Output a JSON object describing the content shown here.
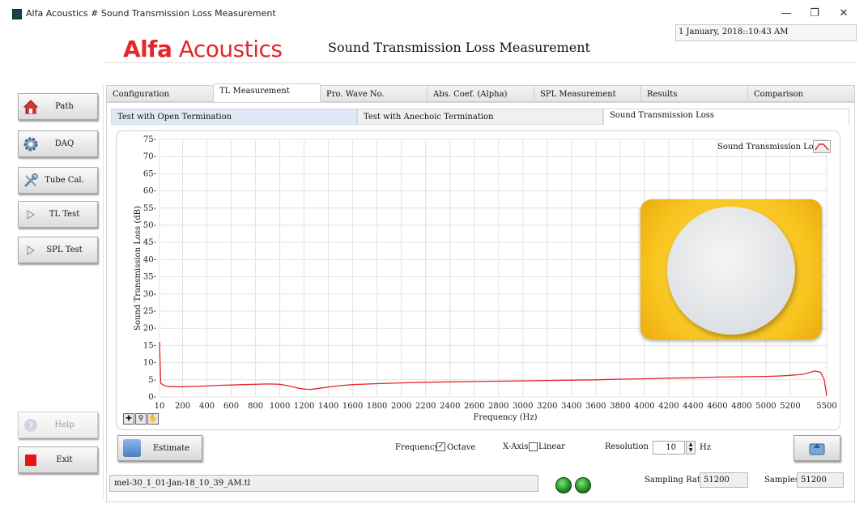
{
  "window": {
    "title": "Alfa Acoustics # Sound Transmission Loss Measurement",
    "min_glyph": "—",
    "max_glyph": "❐",
    "close_glyph": "✕"
  },
  "header": {
    "brand_first": "Alfa",
    "brand_second": " Acoustics",
    "title": "Sound Transmission Loss Measurement",
    "datetime": "1 January, 2018::10:43 AM",
    "brand_color": "#e5262c"
  },
  "sidebar": {
    "items": [
      {
        "label": "Path",
        "icon": "home-icon"
      },
      {
        "label": "DAQ",
        "icon": "gear-icon"
      },
      {
        "label": "Tube Cal.",
        "icon": "tools-icon"
      },
      {
        "label": "TL Test",
        "icon": "play-icon"
      },
      {
        "label": "SPL Test",
        "icon": "play-icon"
      }
    ],
    "help_label": "Help",
    "exit_label": "Exit"
  },
  "tabs": [
    {
      "label": "Configuration",
      "active": false
    },
    {
      "label": "TL Measurement",
      "active": true
    },
    {
      "label": "Pro. Wave No.",
      "active": false
    },
    {
      "label": "Abs. Coef. (Alpha)",
      "active": false
    },
    {
      "label": "SPL Measurement",
      "active": false
    },
    {
      "label": "Results",
      "active": false
    },
    {
      "label": "Comparison",
      "active": false
    }
  ],
  "subtabs": [
    {
      "label": "Test with Open Termination"
    },
    {
      "label": "Test with Anechoic Termination"
    },
    {
      "label": "Sound Transmission Loss"
    }
  ],
  "chart_data": {
    "type": "line",
    "xlabel": "Frequency (Hz)",
    "ylabel": "Sound Transmission Loss (dB)",
    "xlim": [
      10,
      5500
    ],
    "ylim": [
      0,
      75
    ],
    "x_ticks": [
      10,
      200,
      400,
      600,
      800,
      1000,
      1200,
      1400,
      1600,
      1800,
      2000,
      2200,
      2400,
      2600,
      2800,
      3000,
      3200,
      3400,
      3600,
      3800,
      4000,
      4200,
      4400,
      4600,
      4800,
      5000,
      5200,
      5500
    ],
    "y_ticks": [
      0,
      5,
      10,
      15,
      20,
      25,
      30,
      35,
      40,
      45,
      50,
      55,
      60,
      65,
      70,
      75
    ],
    "grid": true,
    "legend_position": "top-right",
    "series": [
      {
        "name": "Sound Transmission Loss",
        "color": "#e8242a",
        "x": [
          10,
          20,
          40,
          60,
          100,
          200,
          300,
          400,
          500,
          600,
          700,
          800,
          900,
          1000,
          1050,
          1100,
          1150,
          1200,
          1250,
          1300,
          1400,
          1500,
          1600,
          1800,
          2000,
          2200,
          2400,
          2600,
          2800,
          3000,
          3200,
          3400,
          3600,
          3800,
          4000,
          4200,
          4400,
          4600,
          4800,
          5000,
          5100,
          5200,
          5300,
          5350,
          5400,
          5450,
          5480,
          5500
        ],
        "y": [
          16,
          4,
          3.5,
          3.2,
          3.0,
          3.0,
          3.1,
          3.2,
          3.4,
          3.5,
          3.6,
          3.7,
          3.8,
          3.7,
          3.4,
          3.0,
          2.6,
          2.3,
          2.2,
          2.4,
          2.9,
          3.3,
          3.6,
          3.9,
          4.1,
          4.3,
          4.4,
          4.5,
          4.6,
          4.7,
          4.8,
          4.9,
          5.0,
          5.2,
          5.3,
          5.5,
          5.6,
          5.8,
          5.9,
          6.0,
          6.1,
          6.3,
          6.6,
          7.0,
          7.6,
          7.2,
          5.0,
          0.3
        ]
      }
    ]
  },
  "controls": {
    "estimate_label": "Estimate",
    "frequency_label": "Frequency",
    "octave_label": "Octave",
    "octave_checked": true,
    "xaxis_label": "X-Axis",
    "linear_label": "Linear",
    "linear_checked": false,
    "resolution_label": "Resolution",
    "resolution_value": "10",
    "resolution_unit": "Hz"
  },
  "status": {
    "file_name": "mel-30_1_01-Jan-18_10_39_AM.tl",
    "sampling_rate_label": "Sampling Rate",
    "sampling_rate_value": "51200",
    "samples_label": "Samples",
    "samples_value": "51200"
  }
}
